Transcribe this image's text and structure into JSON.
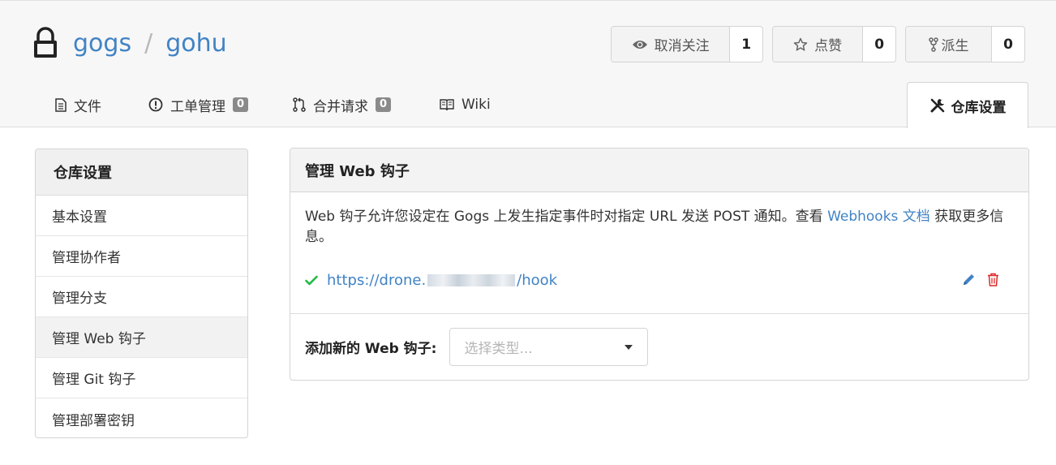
{
  "header": {
    "owner": "gogs",
    "separator": "/",
    "repo": "gohu"
  },
  "actions": {
    "watch": {
      "label": "取消关注",
      "count": "1"
    },
    "star": {
      "label": "点赞",
      "count": "0"
    },
    "fork": {
      "label": "派生",
      "count": "0"
    }
  },
  "tabs": [
    {
      "label": "文件"
    },
    {
      "label": "工单管理",
      "count": "0"
    },
    {
      "label": "合并请求",
      "count": "0"
    },
    {
      "label": "Wiki"
    }
  ],
  "active_tab": {
    "label": "仓库设置"
  },
  "sidebar": {
    "title": "仓库设置",
    "items": [
      {
        "label": "基本设置"
      },
      {
        "label": "管理协作者"
      },
      {
        "label": "管理分支"
      },
      {
        "label": "管理 Web 钩子"
      },
      {
        "label": "管理 Git 钩子"
      },
      {
        "label": "管理部署密钥"
      }
    ]
  },
  "panel": {
    "title": "管理 Web 钩子",
    "description_before": "Web 钩子允许您设定在 Gogs 上发生指定事件时对指定 URL 发送 POST 通知。查看 ",
    "description_link": "Webhooks 文档",
    "description_after": " 获取更多信息。",
    "hook": {
      "url_prefix": "https://drone.",
      "url_suffix": "/hook",
      "status": "success"
    },
    "add_label": "添加新的 Web 钩子:",
    "select_placeholder": "选择类型..."
  },
  "colors": {
    "link": "#4183c4",
    "success": "#21ba45",
    "danger": "#db2828"
  },
  "icons": [
    "lock-icon",
    "eye-icon",
    "star-icon",
    "fork-icon",
    "file-text-icon",
    "issue-icon",
    "pull-request-icon",
    "book-icon",
    "wrench-icon",
    "check-icon",
    "pencil-icon",
    "trash-icon",
    "dropdown-caret-icon"
  ]
}
